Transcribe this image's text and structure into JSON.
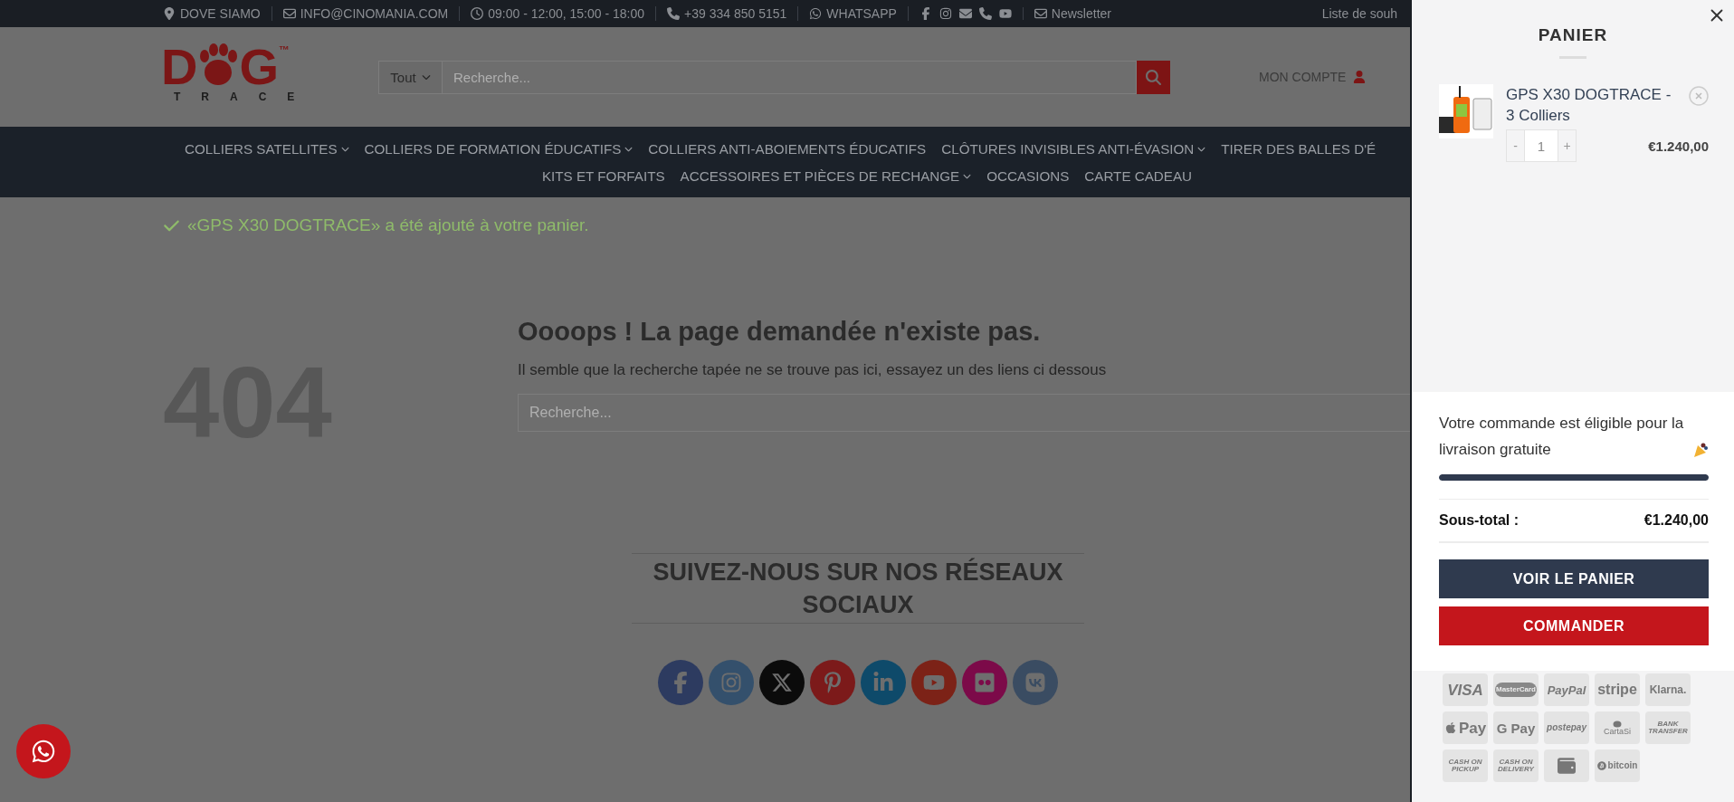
{
  "top_bar": {
    "items": [
      {
        "kind": "location",
        "label": "DOVE SIAMO"
      },
      {
        "kind": "mail",
        "label": "INFO@CINOMANIA.COM"
      },
      {
        "kind": "clock",
        "label": "09:00 - 12:00, 15:00 - 18:00"
      },
      {
        "kind": "phone",
        "label": "+39 334 850 5151"
      },
      {
        "kind": "whatsapp",
        "label": "WHATSAPP"
      }
    ],
    "newsletter": "Newsletter",
    "wishlist": "Liste de souh"
  },
  "header": {
    "logo": {
      "initial": "D",
      "final": "G",
      "trademark": "™",
      "tagline": "TRACE"
    },
    "search": {
      "category": "Tout",
      "placeholder": "Recherche..."
    },
    "account": "MON COMPTE"
  },
  "nav": {
    "rows": [
      {
        "items": [
          {
            "label": "COLLIERS SATELLITES",
            "has_menu": true
          },
          {
            "label": "COLLIERS DE FORMATION ÉDUCATIFS",
            "has_menu": true
          },
          {
            "label": "COLLIERS ANTI-ABOIEMENTS ÉDUCATIFS",
            "has_menu": false
          },
          {
            "label": "CLÔTURES INVISIBLES ANTI-ÉVASION",
            "has_menu": true
          },
          {
            "label": "TIRER DES BALLES D'É",
            "has_menu": false
          }
        ]
      },
      {
        "items": [
          {
            "label": "KITS ET FORFAITS",
            "has_menu": false
          },
          {
            "label": "ACCESSOIRES ET PIÈCES DE RECHANGE",
            "has_menu": true
          },
          {
            "label": "OCCASIONS",
            "has_menu": false
          },
          {
            "label": "CARTE CADEAU",
            "has_menu": false
          }
        ]
      }
    ]
  },
  "notice": "«GPS X30 DOGTRACE» a été ajouté à votre panier.",
  "error": {
    "code": "404",
    "title": "Oooops ! La page demandée n'existe pas.",
    "message": "Il semble que la recherche tapée ne se trouve pas ici, essayez un des liens ci dessous",
    "search_placeholder": "Recherche..."
  },
  "social": {
    "title": "SUIVEZ-NOUS SUR NOS RÉSEAUX SOCIAUX"
  },
  "cart": {
    "title": "PANIER",
    "items": [
      {
        "name": "GPS X30 DOGTRACE - 3 Colliers",
        "minus": "-",
        "quantity": "1",
        "plus": "+",
        "price": "€1.240,00"
      }
    ],
    "shipping": {
      "message": "Votre commande est éligible pour la livraison gratuite",
      "level": 1
    },
    "subtotal_label": "Sous-total :",
    "subtotal": "€1.240,00",
    "buttons": [
      {
        "label": "VOIR LE PANIER",
        "kind": "secondary"
      },
      {
        "label": "COMMANDER",
        "kind": "primary"
      }
    ],
    "payments": [
      {
        "kind": "visa",
        "label": "VISA"
      },
      {
        "kind": "mastercard",
        "label": "MasterCard"
      },
      {
        "kind": "italic",
        "label": "PayPal"
      },
      {
        "kind": "bold",
        "label": "stripe"
      },
      {
        "kind": "bold",
        "label": "Klarna."
      },
      {
        "kind": "apple",
        "label": "Pay"
      },
      {
        "kind": "google",
        "label": "G Pay"
      },
      {
        "kind": "italic",
        "label": "postepay"
      },
      {
        "kind": "cartasi",
        "label": "CartaSi"
      },
      {
        "kind": "small",
        "label": "BANK TRANSFER"
      },
      {
        "kind": "small",
        "label": "CASH ON PICKUP"
      },
      {
        "kind": "small",
        "label": "CASH ON DELIVERY"
      },
      {
        "kind": "wallet"
      },
      {
        "kind": "bitcoin",
        "label": "bitcoin"
      }
    ]
  }
}
